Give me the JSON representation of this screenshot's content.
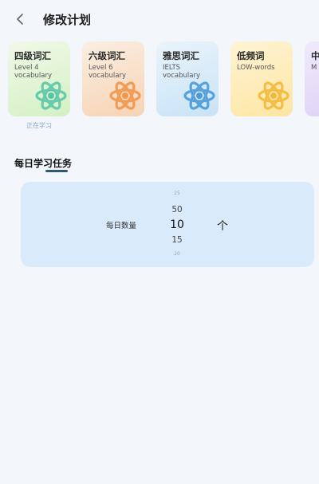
{
  "header": {
    "title": "修改计划"
  },
  "cards": [
    {
      "name": "四级词汇",
      "sub": "Level 4 vocabulary",
      "color": "#58c7a8"
    },
    {
      "name": "六级词汇",
      "sub": "Level 6 vocabulary",
      "color": "#f0954a"
    },
    {
      "name": "雅思词汇",
      "sub": "IELTS vocabulary",
      "color": "#4b9ad8"
    },
    {
      "name": "低频词",
      "sub": "LOW-words",
      "color": "#f3b93a"
    },
    {
      "name": "中",
      "sub": "M w",
      "color": "#a58ae0"
    }
  ],
  "learning_label": "正在学习",
  "task": {
    "tab": "每日学习任务",
    "label": "每日数量",
    "picker": [
      "25",
      "50",
      "10",
      "15",
      "20"
    ],
    "unit": "个"
  }
}
